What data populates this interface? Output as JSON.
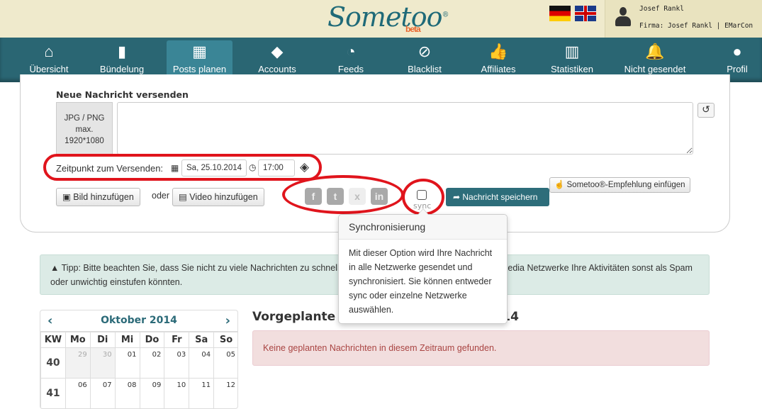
{
  "header": {
    "logo": "Sometoo",
    "logo_badge": "beta",
    "user_name": "Josef Rankl",
    "company": "Firma: Josef Rankl | EMarCon",
    "languages": [
      "de",
      "en"
    ]
  },
  "nav": [
    {
      "label": "Übersicht",
      "icon": "home-icon",
      "glyph": "⌂"
    },
    {
      "label": "Bündelung",
      "icon": "bookmark-icon",
      "glyph": "▮"
    },
    {
      "label": "Posts planen",
      "icon": "calendar-icon",
      "glyph": "▦",
      "active": true
    },
    {
      "label": "Accounts",
      "icon": "tags-icon",
      "glyph": "◆"
    },
    {
      "label": "Feeds",
      "icon": "rss-icon",
      "glyph": "◔"
    },
    {
      "label": "Blacklist",
      "icon": "ban-icon",
      "glyph": "⊘"
    },
    {
      "label": "Affiliates",
      "icon": "thumbs-up-icon",
      "glyph": "👍"
    },
    {
      "label": "Statistiken",
      "icon": "bar-chart-icon",
      "glyph": "▥"
    },
    {
      "label": "Nicht gesendet",
      "icon": "bell-icon",
      "glyph": "🔔"
    },
    {
      "label": "Profil",
      "icon": "user-icon",
      "glyph": "●"
    }
  ],
  "composer": {
    "title": "Neue Nachricht versenden",
    "image_hint": [
      "JPG / PNG",
      "max.",
      "1920*1080"
    ],
    "message_value": "",
    "schedule_label": "Zeitpunkt zum Versenden:",
    "date": "Sa, 25.10.2014",
    "time": "17:00",
    "add_image": "Bild hinzufügen",
    "or": "oder",
    "add_video": "Video hinzufügen",
    "networks": [
      "f",
      "t",
      "x",
      "in"
    ],
    "sync_label": "sync",
    "save": "Nachricht speichern",
    "recommend": "Sometoo®-Empfehlung einfügen",
    "annotation_color": "#e0141c"
  },
  "popover": {
    "title": "Synchronisierung",
    "body": "Mit dieser Option wird Ihre Nachricht in alle Netzwerke gesendet und synchronisiert. Sie können entweder sync oder einzelne Netzwerke auswählen."
  },
  "tip": {
    "text": "Tipp: Bitte beachten Sie, dass Sie nicht zu viele Nachrichten zu schnell hintereinander versenden, da die Social Media Netzwerke Ihre Aktivitäten sonst als Spam oder unwichtig einstufen könnten."
  },
  "calendar": {
    "month": "Oktober 2014",
    "headers": [
      "KW",
      "Mo",
      "Di",
      "Mi",
      "Do",
      "Fr",
      "Sa",
      "So"
    ],
    "weeks": [
      {
        "kw": "40",
        "days": [
          "29",
          "30",
          "01",
          "02",
          "03",
          "04",
          "05"
        ]
      },
      {
        "kw": "41",
        "days": [
          "06",
          "07",
          "08",
          "09",
          "10",
          "11",
          "12"
        ]
      }
    ]
  },
  "scheduled": {
    "title": "Vorgeplante Nachrichten Oktober 2014",
    "empty": "Keine geplanten Nachrichten in diesem Zeitraum gefunden."
  }
}
